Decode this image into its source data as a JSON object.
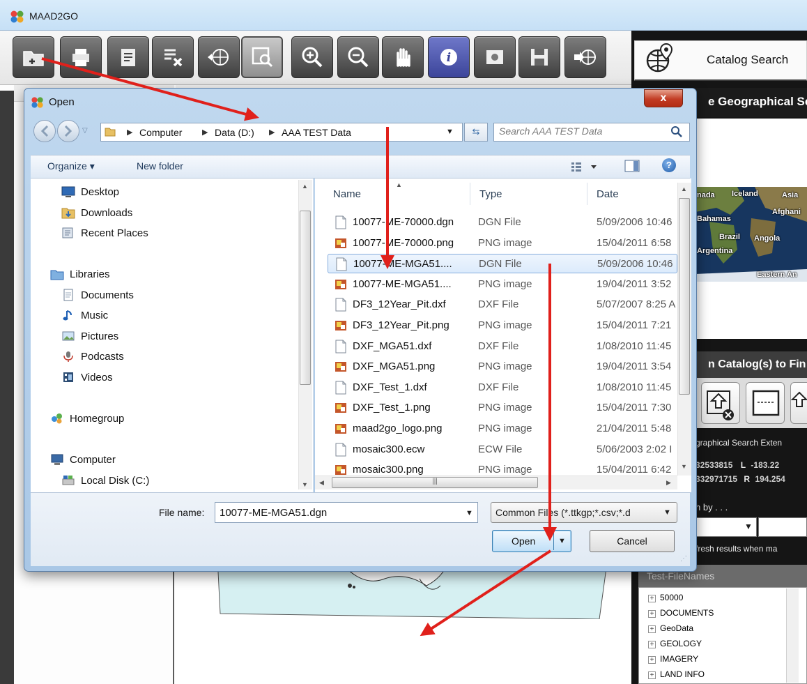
{
  "app": {
    "title": "MAAD2GO",
    "brand_color": "#c23c24"
  },
  "toolbar": {
    "tools": [
      {
        "name": "open-file-icon"
      },
      {
        "name": "print-icon"
      },
      {
        "name": "edit-document-icon"
      },
      {
        "name": "clear-layers-icon"
      },
      {
        "name": "world-zoom-icon"
      },
      {
        "name": "zoom-window-icon"
      },
      {
        "name": "zoom-in-icon"
      },
      {
        "name": "zoom-out-icon"
      },
      {
        "name": "pan-hand-icon"
      },
      {
        "name": "info-icon"
      },
      {
        "name": "layer-image-icon"
      },
      {
        "name": "save-icon"
      },
      {
        "name": "export-world-icon"
      }
    ]
  },
  "right_panel": {
    "catalog_tab": "Catalog Search",
    "geo_header": "e Geographical Se",
    "map_labels": [
      "nada",
      "Iceland",
      "Asia",
      "Bahamas",
      "Afghani",
      "Brazil",
      "Angola",
      "Argentina",
      "Eastern An"
    ],
    "catalog_find": "n Catalog(s) to Fin",
    "extent_label": "graphical Search Exten",
    "extent_row1": {
      "a": "32533815",
      "l_label": "L",
      "l_value": "-183.22"
    },
    "extent_row2": {
      "a": "332971715",
      "r_label": "R",
      "r_value": "194.254"
    },
    "search_by": "h by . . .",
    "refresh_text": "fresh results when ma",
    "names_header": "Test-FileNames",
    "tree_items": [
      "50000",
      "DOCUMENTS",
      "GeoData",
      "GEOLOGY",
      "IMAGERY",
      "LAND INFO"
    ]
  },
  "dialog": {
    "title": "Open",
    "close_label": "x",
    "breadcrumbs": [
      "Computer",
      "Data (D:)",
      "AAA TEST Data"
    ],
    "search_placeholder": "Search AAA TEST Data",
    "organize_label": "Organize ▾",
    "new_folder_label": "New folder",
    "nav_items": [
      {
        "label": "Desktop",
        "icon": "desktop-icon"
      },
      {
        "label": "Downloads",
        "icon": "downloads-folder-icon"
      },
      {
        "label": "Recent Places",
        "icon": "recent-places-icon"
      },
      {
        "label": "Libraries",
        "icon": "libraries-icon"
      },
      {
        "label": "Documents",
        "icon": "documents-icon"
      },
      {
        "label": "Music",
        "icon": "music-icon"
      },
      {
        "label": "Pictures",
        "icon": "pictures-icon"
      },
      {
        "label": "Podcasts",
        "icon": "podcasts-icon"
      },
      {
        "label": "Videos",
        "icon": "videos-icon"
      },
      {
        "label": "Homegroup",
        "icon": "homegroup-icon"
      },
      {
        "label": "Computer",
        "icon": "computer-icon"
      },
      {
        "label": "Local Disk (C:)",
        "icon": "local-disk-icon"
      }
    ],
    "columns": {
      "name": "Name",
      "type": "Type",
      "date": "Date"
    },
    "files": [
      {
        "name": "10077-ME-70000.dgn",
        "type": "DGN File",
        "date": "5/09/2006 10:46",
        "kind": "doc"
      },
      {
        "name": "10077-ME-70000.png",
        "type": "PNG image",
        "date": "15/04/2011 6:58",
        "kind": "png"
      },
      {
        "name": "10077-ME-MGA51....",
        "type": "DGN File",
        "date": "5/09/2006 10:46",
        "kind": "doc",
        "selected": true
      },
      {
        "name": "10077-ME-MGA51....",
        "type": "PNG image",
        "date": "19/04/2011 3:52",
        "kind": "png"
      },
      {
        "name": "DF3_12Year_Pit.dxf",
        "type": "DXF File",
        "date": "5/07/2007 8:25 A",
        "kind": "doc"
      },
      {
        "name": "DF3_12Year_Pit.png",
        "type": "PNG image",
        "date": "15/04/2011 7:21",
        "kind": "png"
      },
      {
        "name": "DXF_MGA51.dxf",
        "type": "DXF File",
        "date": "1/08/2010 11:45",
        "kind": "doc"
      },
      {
        "name": "DXF_MGA51.png",
        "type": "PNG image",
        "date": "19/04/2011 3:54",
        "kind": "png"
      },
      {
        "name": "DXF_Test_1.dxf",
        "type": "DXF File",
        "date": "1/08/2010 11:45",
        "kind": "doc"
      },
      {
        "name": "DXF_Test_1.png",
        "type": "PNG image",
        "date": "15/04/2011 7:30",
        "kind": "png"
      },
      {
        "name": "maad2go_logo.png",
        "type": "PNG image",
        "date": "21/04/2011 5:48",
        "kind": "png"
      },
      {
        "name": "mosaic300.ecw",
        "type": "ECW File",
        "date": "5/06/2003 2:02 I",
        "kind": "doc"
      },
      {
        "name": "mosaic300.png",
        "type": "PNG image",
        "date": "15/04/2011 6:42",
        "kind": "png"
      }
    ],
    "file_name_label": "File name:",
    "file_name_value": "10077-ME-MGA51.dgn",
    "file_type_value": "Common Files (*.ttkgp;*.csv;*.d",
    "open_label": "Open",
    "cancel_label": "Cancel",
    "scroll_grip": "|||"
  }
}
